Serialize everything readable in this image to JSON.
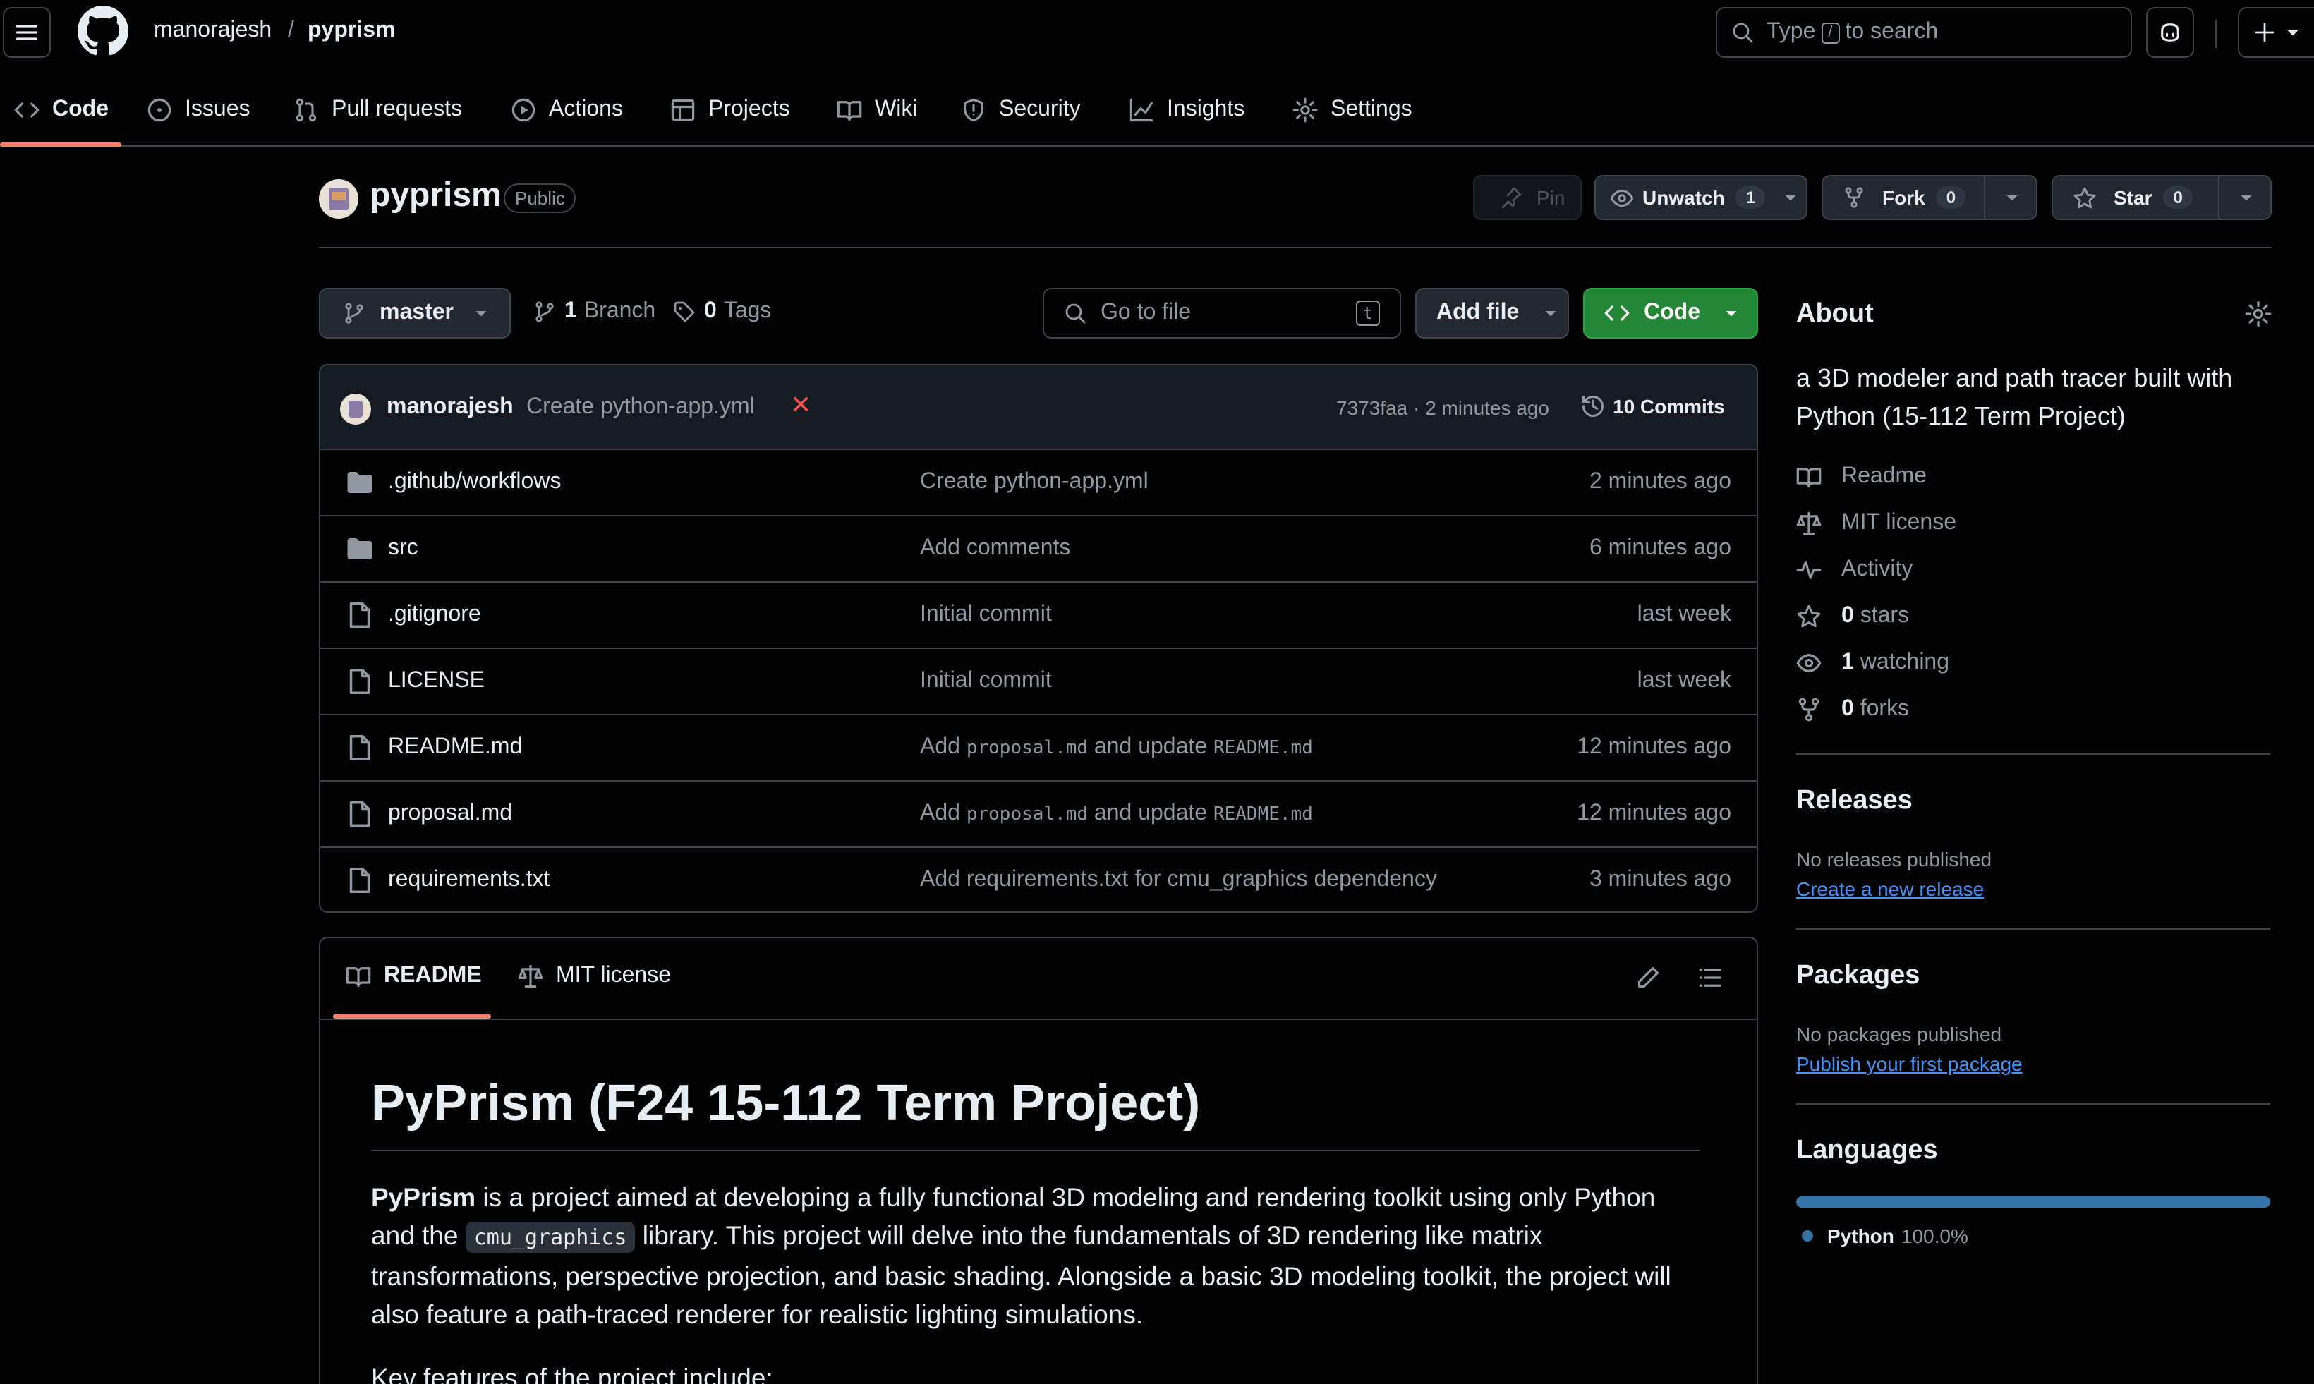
{
  "header": {
    "owner": "manorajesh",
    "slash": "/",
    "repo": "pyprism",
    "search_prefix": "Type",
    "search_key": "/",
    "search_suffix": "to search"
  },
  "nav": {
    "tabs": [
      {
        "label": "Code",
        "icon": "code-icon"
      },
      {
        "label": "Issues",
        "icon": "issue-icon"
      },
      {
        "label": "Pull requests",
        "icon": "pull-request-icon"
      },
      {
        "label": "Actions",
        "icon": "play-icon"
      },
      {
        "label": "Projects",
        "icon": "table-icon"
      },
      {
        "label": "Wiki",
        "icon": "book-icon"
      },
      {
        "label": "Security",
        "icon": "shield-icon"
      },
      {
        "label": "Insights",
        "icon": "graph-icon"
      },
      {
        "label": "Settings",
        "icon": "gear-icon"
      }
    ]
  },
  "repo": {
    "name": "pyprism",
    "visibility": "Public",
    "pin": "Pin",
    "unwatch": "Unwatch",
    "watch_count": "1",
    "fork": "Fork",
    "fork_count": "0",
    "star": "Star",
    "star_count": "0"
  },
  "toolbar": {
    "branch": "master",
    "branch_count": "1",
    "branch_label": "Branch",
    "tag_count": "0",
    "tag_label": "Tags",
    "goto_placeholder": "Go to file",
    "goto_key": "t",
    "add_file": "Add file",
    "code": "Code"
  },
  "commit": {
    "author": "manorajesh",
    "message": "Create python-app.yml",
    "status": "✕",
    "hash_time": "7373faa · 2 minutes ago",
    "commits": "10 Commits"
  },
  "files": [
    {
      "type": "dir",
      "name": ".github/workflows",
      "msg": "Create python-app.yml",
      "time": "2 minutes ago"
    },
    {
      "type": "dir",
      "name": "src",
      "msg": "Add comments",
      "time": "6 minutes ago"
    },
    {
      "type": "file",
      "name": ".gitignore",
      "msg": "Initial commit",
      "time": "last week"
    },
    {
      "type": "file",
      "name": "LICENSE",
      "msg": "Initial commit",
      "time": "last week"
    },
    {
      "type": "file",
      "name": "README.md",
      "msg_parts": [
        "Add ",
        "proposal.md",
        " and update ",
        "README.md"
      ],
      "time": "12 minutes ago"
    },
    {
      "type": "file",
      "name": "proposal.md",
      "msg_parts": [
        "Add ",
        "proposal.md",
        " and update ",
        "README.md"
      ],
      "time": "12 minutes ago"
    },
    {
      "type": "file",
      "name": "requirements.txt",
      "msg": "Add requirements.txt for cmu_graphics dependency",
      "time": "3 minutes ago"
    }
  ],
  "readme": {
    "tab_readme": "README",
    "tab_license": "MIT license",
    "title": "PyPrism (F24 15-112 Term Project)",
    "p1_bold": "PyPrism",
    "p1_a": " is a project aimed at developing a fully functional 3D modeling and rendering toolkit using only Python and the ",
    "p1_code": "cmu_graphics",
    "p1_b": " library. This project will delve into the fundamentals of 3D rendering like matrix transformations, perspective projection, and basic shading. Alongside a basic 3D modeling toolkit, the project will also feature a path-traced renderer for realistic lighting simulations.",
    "p2": "Key features of the project include:"
  },
  "about": {
    "heading": "About",
    "description": "a 3D modeler and path tracer built with Python (15-112 Term Project)",
    "readme": "Readme",
    "license": "MIT license",
    "activity": "Activity",
    "stars_n": "0",
    "stars": "stars",
    "watching_n": "1",
    "watching": "watching",
    "forks_n": "0",
    "forks": "forks"
  },
  "releases": {
    "heading": "Releases",
    "none": "No releases published",
    "link": "Create a new release"
  },
  "packages": {
    "heading": "Packages",
    "none": "No packages published",
    "link": "Publish your first package"
  },
  "languages": {
    "heading": "Languages",
    "name": "Python",
    "percent": "100.0%",
    "color": "#3572A5",
    "fraction": 1.0
  },
  "colors": {
    "accent_tab": "#f78166",
    "code_button": "#238636",
    "link": "#4493f8",
    "error": "#f85149"
  }
}
